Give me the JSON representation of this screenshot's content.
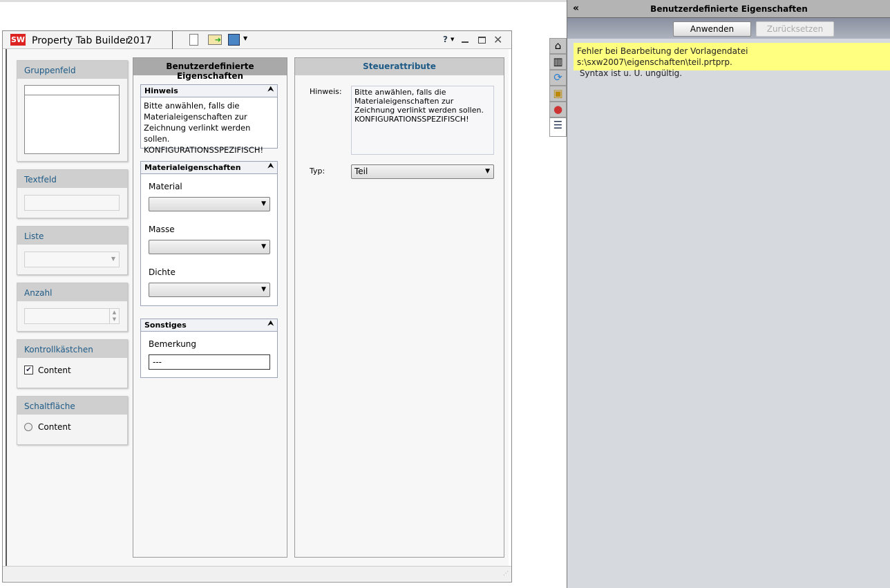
{
  "app": {
    "title": "Property Tab Builder",
    "version": "2017",
    "logo": "SW"
  },
  "toolbar": {
    "icons": [
      "new-file-icon",
      "open-folder-icon",
      "save-icon"
    ],
    "help": "?"
  },
  "left_panels": [
    {
      "label": "Gruppenfeld"
    },
    {
      "label": "Textfeld"
    },
    {
      "label": "Liste"
    },
    {
      "label": "Anzahl"
    },
    {
      "label": "Kontrollkästchen",
      "content": "Content",
      "checked": true
    },
    {
      "label": "Schaltfläche",
      "content": "Content",
      "checked": false
    }
  ],
  "middle": {
    "title": "Benutzerdefinierte Eigenschaften",
    "hinweis": {
      "title": "Hinweis",
      "text": "Bitte anwählen, falls die Materialeigenschaften zur Zeichnung verlinkt werden sollen. KONFIGURATIONSSPEZIFISCH!"
    },
    "material": {
      "title": "Materialeigenschaften",
      "fields": [
        {
          "label": "Material",
          "value": ""
        },
        {
          "label": "Masse",
          "value": ""
        },
        {
          "label": "Dichte",
          "value": ""
        }
      ]
    },
    "sonstiges": {
      "title": "Sonstiges",
      "label": "Bemerkung",
      "value": "---"
    }
  },
  "right": {
    "title": "Steuerattribute",
    "hinweis_label": "Hinweis:",
    "hinweis_text": "Bitte anwählen, falls die Materialeigenschaften zur Zeichnung verlinkt werden sollen. KONFIGURATIONSSPEZIFISCH!",
    "typ_label": "Typ:",
    "typ_value": "Teil"
  },
  "side": {
    "title": "Benutzerdefinierte Eigenschaften",
    "apply": "Anwenden",
    "reset": "Zurücksetzen",
    "message_line1": "Fehler bei Bearbeitung der Vorlagendatei s:\\sxw2007\\eigenschaften\\teil.prtprp.",
    "message_line2": " Syntax ist u. U. ungültig.",
    "collapse": "«"
  }
}
